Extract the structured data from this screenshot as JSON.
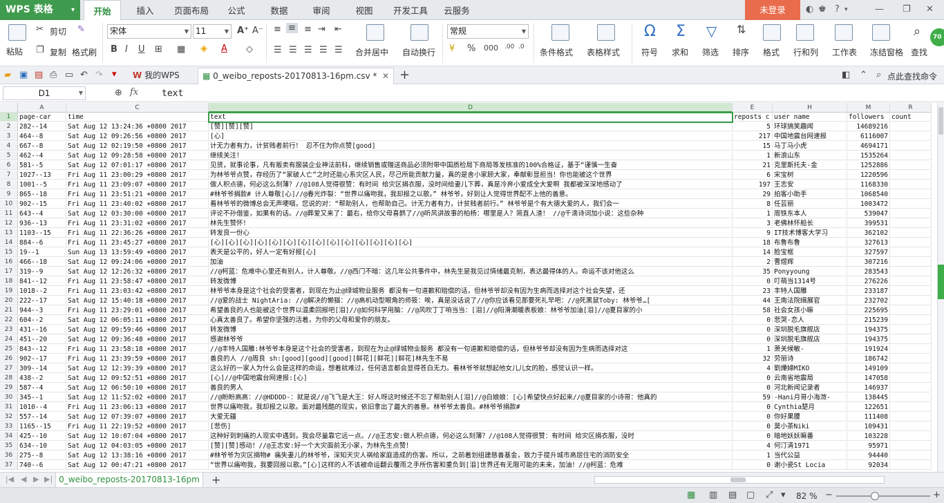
{
  "app": {
    "name": "WPS 表格",
    "login": "未登录"
  },
  "menu": [
    "开始",
    "插入",
    "页面布局",
    "公式",
    "数据",
    "审阅",
    "视图",
    "开发工具",
    "云服务"
  ],
  "ribbon": {
    "paste": "粘贴",
    "cut": "剪切",
    "copy": "复制",
    "format_painter": "格式刷",
    "font": "宋体",
    "font_size": "11",
    "merge": "合并居中",
    "wrap": "自动换行",
    "number_format": "常规",
    "cond_format": "条件格式",
    "table_style": "表格样式",
    "symbol": "符号",
    "sum": "求和",
    "filter": "筛选",
    "sort": "排序",
    "format": "格式",
    "rowcol": "行和列",
    "worksheet": "工作表",
    "freeze": "冻结窗格",
    "find": "查找",
    "zoom_badge": "70"
  },
  "tabs": {
    "home": "我的WPS",
    "file": "0_weibo_reposts-20170813-16pm.csv *",
    "search": "点此查找命令"
  },
  "formula": {
    "cell": "D1",
    "fx": "fx",
    "value": "text"
  },
  "columns": [
    "A",
    "C",
    "D",
    "E",
    "H",
    "M",
    "R"
  ],
  "rows": [
    {
      "n": "1",
      "a": "page-car",
      "c": "time",
      "d": "text",
      "e": "reposts c",
      "h": "user name",
      "m": "followers",
      "r": "count"
    },
    {
      "n": "2",
      "a": "282--14",
      "c": "Sat Aug 12 13:24:36 +0800 2017",
      "d": "[赞][赞][赞]",
      "e": "5",
      "h": "环球搞笑趣闻",
      "m": "14689216",
      "r": ""
    },
    {
      "n": "3",
      "a": "464--8",
      "c": "Sat Aug 12 09:26:56 +0800 2017",
      "d": "[心]",
      "e": "217",
      "h": "中国地震台网速报",
      "m": "6116007",
      "r": ""
    },
    {
      "n": "4",
      "a": "667--8",
      "c": "Sat Aug 12 02:19:50 +0800 2017",
      "d": "计无力者有力，计贫贱者前行！ 忍不住为你点赞[good]",
      "e": "15",
      "h": "马丁马小虎",
      "m": "4694171",
      "r": ""
    },
    {
      "n": "5",
      "a": "462--4",
      "c": "Sat Aug 12 09:28:58 +0800 2017",
      "d": "继续关注！",
      "e": "1",
      "h": "新浪山东",
      "m": "1535264",
      "r": ""
    },
    {
      "n": "6",
      "a": "581--5",
      "c": "Sat Aug 12 07:01:17 +0800 2017",
      "d": "见贤，就事论事，凡有贩卖有服装企业神法前科，继续销售或赠送商品必须附带中国质检局下商局等发核准的100%合格证，基于“谨慎一生奋",
      "e": "21",
      "h": "克里斯托夫-金",
      "m": "1252886",
      "r": ""
    },
    {
      "n": "7",
      "a": "1027--13",
      "c": "Fri Aug 11 23:00:29 +0800 2017",
      "d": "为林爷爷点赞，存经历了“家破人亡”之时还能心系灾区人民，尽己所能贡献力量，真的是舍小家顾大家，奉献彰显担当！你也能被这个世界",
      "e": "6",
      "h": "宋宝树",
      "m": "1220596",
      "r": ""
    },
    {
      "n": "8",
      "a": "1001--5",
      "c": "Fri Aug 11 23:09:07 +0800 2017",
      "d": "做人积点德，何必这么刻薄？//@108人觉得很赞：有时间 给灾区捐衣服，没时间给妻儿下葬，真是冷弃小爱成全大爱啊 我都被深深地感动了",
      "e": "197",
      "h": "王志安",
      "m": "1168330",
      "r": ""
    },
    {
      "n": "9",
      "a": "865--18",
      "c": "Fri Aug 11 23:51:21 +0800 2017",
      "d": "#林爷爷捐款# 计人尊敬[心]//@春光炸裂：“世界以痛吻我，我却报之以歌。” 林爷爷，好到让人觉得世界配不上他的善意。",
      "e": "29",
      "h": "拍客小助手",
      "m": "1068540",
      "r": ""
    },
    {
      "n": "10",
      "a": "902--15",
      "c": "Fri Aug 11 23:40:02 +0800 2017",
      "d": "看林爷爷的微博总会无声哽咽，您说的对：“帮助别人，也帮助自己。计无力者有力，计贫贱者前行。” 林爷爷是个有大德大爱的人，我们会一",
      "e": "8",
      "h": "任芸丽",
      "m": "1003472",
      "r": ""
    },
    {
      "n": "11",
      "a": "643--4",
      "c": "Sat Aug 12 03:30:00 +0800 2017",
      "d": "评论不孙借鉴，如果有的话。//@葬爱又来了：最右，给你父母喜鹊了//@听风讲故事的柏杨：哪里是人？简直人渣！ //@千滴诗词加小说：这些杂种",
      "e": "1",
      "h": "周铁东本人",
      "m": "539047",
      "r": ""
    },
    {
      "n": "12",
      "a": "936--13",
      "c": "Fri Aug 11 23:31:02 +0800 2017",
      "d": "林先生赞怀！",
      "e": "3",
      "h": "老佛林怀船长",
      "m": "399531",
      "r": ""
    },
    {
      "n": "13",
      "a": "1103--15",
      "c": "Fri Aug 11 22:36:26 +0800 2017",
      "d": "转发良一份心",
      "e": "9",
      "h": "IT技术博客大学习",
      "m": "362102",
      "r": ""
    },
    {
      "n": "14",
      "a": "884--6",
      "c": "Fri Aug 11 23:45:27 +0800 2017",
      "d": "[心][心][心][心][心][心][心][心][心][心][心][心][心][心]",
      "e": "18",
      "h": "布鲁布鲁",
      "m": "327613",
      "r": ""
    },
    {
      "n": "15",
      "a": "19--1",
      "c": "Sun Aug 13 13:59:49 +0800 2017",
      "d": "表天是公平的，好人一定有好报[心]",
      "e": "14",
      "h": "脸宝框",
      "m": "327597",
      "r": ""
    },
    {
      "n": "16",
      "a": "466--18",
      "c": "Sat Aug 12 09:24:06 +0800 2017",
      "d": "加油",
      "e": "2",
      "h": "曹煜辉",
      "m": "307216",
      "r": ""
    },
    {
      "n": "17",
      "a": "319--9",
      "c": "Sat Aug 12 12:26:32 +0800 2017",
      "d": "//@柯蓝：危难中心里还有别人，计人尊敬。//@西门不暗：这几年公共事件中，林先生是我见过情绪最克制，表达最得体的人。命运不该对他这么",
      "e": "35",
      "h": "Ponyyoung",
      "m": "283543",
      "r": ""
    },
    {
      "n": "18",
      "a": "841--12",
      "c": "Fri Aug 11 23:58:47 +0800 2017",
      "d": "转发微博",
      "e": "0",
      "h": "叮萌当1314号",
      "m": "276226",
      "r": ""
    },
    {
      "n": "19",
      "a": "1018--2",
      "c": "Fri Aug 11 23:03:42 +0800 2017",
      "d": "林爷爷本身是这个社会的受害者，到现在为止@绿城物业服务 都没有一句道歉和赔偿的话，但林爷爷却没有因为生病而选择对这个社会失望，还",
      "e": "23",
      "h": "丰特人国雕",
      "m": "233187",
      "r": ""
    },
    {
      "n": "20",
      "a": "222--17",
      "c": "Sat Aug 12 15:40:18 +0800 2017",
      "d": "//@爱的战士 NightAria: //@解决的懒猫：//@高机动型眼角的师筱：唉，真是没话说了//@你应该看见那要死礼早吧：//@死黑鼠Toby: 林爷爷…[",
      "e": "44",
      "h": "王南法院缉展官",
      "m": "232702",
      "r": ""
    },
    {
      "n": "21",
      "a": "944--3",
      "c": "Fri Aug 11 23:29:01 +0800 2017",
      "d": "希望善良的人也能被这个世界以温柔回报吧[泪]//@如何科学用脑：//@风吹丁丁响当当：[泪]//@阳滑潮暖表板娘：林爷爷加油[泪]//@夏目家的小",
      "e": "58",
      "h": "社会女孩小嘛",
      "m": "225695",
      "r": ""
    },
    {
      "n": "22",
      "a": "604--2",
      "c": "Sat Aug 12 06:05:11 +0800 2017",
      "d": "心真太善良了。希望你坚强的活着，为你的父母和爱你的朋友。",
      "e": "0",
      "h": "悲哭-恋人",
      "m": "215239",
      "r": ""
    },
    {
      "n": "23",
      "a": "431--16",
      "c": "Sat Aug 12 09:59:46 +0800 2017",
      "d": "转发微博",
      "e": "0",
      "h": "深圳脱毛旗舰店",
      "m": "194375",
      "r": ""
    },
    {
      "n": "24",
      "a": "451--20",
      "c": "Sat Aug 12 09:36:48 +0800 2017",
      "d": "感谢林爷爷",
      "e": "0",
      "h": "深圳脱毛旗舰店",
      "m": "194375",
      "r": ""
    },
    {
      "n": "25",
      "a": "843--12",
      "c": "Fri Aug 11 23:58:18 +0800 2017",
      "d": "//@丰特人国雕:林爷爷本身是这个社会的受害者，到现在为止@绿城物业服务 都没有一句道歉和赔偿的话，但林爷爷却没有因为生病而选择对这",
      "e": "1",
      "h": "萧关候敏-",
      "m": "191924",
      "r": ""
    },
    {
      "n": "26",
      "a": "902--17",
      "c": "Fri Aug 11 23:39:59 +0800 2017",
      "d": "善良的人 //@周良 sh:[good][good][good][鲜花][鲜花][鲜花]林先生不易",
      "e": "32",
      "h": "劳丽诗",
      "m": "186742",
      "r": ""
    },
    {
      "n": "27",
      "a": "309--14",
      "c": "Sat Aug 12 12:39:39 +0800 2017",
      "d": "这么好的一家人为什么会是这样的命运，想着就难过，任何语言都会显得苍白无力。看林爷爷就想起他女儿儿女的脸，感觉认识一样。",
      "e": "4",
      "h": "劉燁婦MIKO",
      "m": "149109",
      "r": ""
    },
    {
      "n": "28",
      "a": "438--2",
      "c": "Sat Aug 12 09:52:51 +0800 2017",
      "d": "[心]//@中国地震台网速报:[心]",
      "e": "0",
      "h": "云南省地震局",
      "m": "147058",
      "r": ""
    },
    {
      "n": "29",
      "a": "587--4",
      "c": "Sat Aug 12 06:50:10 +0800 2017",
      "d": "善良的男人",
      "e": "0",
      "h": "河北新闻记录者",
      "m": "146937",
      "r": ""
    },
    {
      "n": "30",
      "a": "345--1",
      "c": "Sat Aug 12 11:52:02 +0800 2017",
      "d": "//@盼盼高高：//@HDDDD-：就是说//@飞飞是大王：好人呀这时候还不忘了帮助别人[泪]//@白娘娘：[心]希望快点好起来//@夏目家的小诗哥：他真的",
      "e": "59",
      "h": "-Hani月哥小海溦-",
      "m": "138445",
      "r": ""
    },
    {
      "n": "31",
      "a": "1010--4",
      "c": "Fri Aug 11 23:06:13 +0800 2017",
      "d": "世界以痛吻我，我却报之以歌。面对最残酷的现实，依旧拿出了最大的善意。林爷爷太善良。#林爷爷捐款#",
      "e": "0",
      "h": "Cynthia楚月",
      "m": "122651",
      "r": ""
    },
    {
      "n": "32",
      "a": "557--14",
      "c": "Sat Aug 12 07:39:07 +0800 2017",
      "d": "大爱无疆",
      "e": "0",
      "h": "你好果腰",
      "m": "111408",
      "r": ""
    },
    {
      "n": "33",
      "a": "1165--15",
      "c": "Fri Aug 11 22:19:52 +0800 2017",
      "d": "[悲伤]",
      "e": "0",
      "h": "莫小茶Niki",
      "m": "109431",
      "r": ""
    },
    {
      "n": "34",
      "a": "425--10",
      "c": "Sat Aug 12 10:07:04 +0800 2017",
      "d": "这种好到刺痛的人现实中遇到，我会尽量靠它远一点。//@王志安:做人积点德，何必这么刻薄？//@108人觉得很赞：有时间 给灾区捐衣服，没时",
      "e": "0",
      "h": "暗地妖妖嘛番",
      "m": "103228",
      "r": ""
    },
    {
      "n": "35",
      "a": "634--10",
      "c": "Sat Aug 12 04:03:05 +0800 2017",
      "d": "[赞][赞]感动！//@王志安:好一个大灾面前无小家，为林先生点赞！",
      "e": "4",
      "h": "何汀清1971",
      "m": "95971",
      "r": ""
    },
    {
      "n": "36",
      "a": "275--8",
      "c": "Sat Aug 12 13:38:16 +0800 2017",
      "d": "#林爷爷为灾区捐物# 痛失妻儿的林爷爷，深知天灾人祸给家庭造成的伤害。所以，之前着划组建慈善基金，致力于提升城市高层住宅的消防安全",
      "e": "1",
      "h": "当代公益",
      "m": "94440",
      "r": ""
    },
    {
      "n": "37",
      "a": "740--6",
      "c": "Sat Aug 12 00:47:21 +0800 2017",
      "d": "“世界以痛吻我，我要回报以歌。”[心]这样的人不该被命运翻云覆雨之手所伤害和重负到[泪]世界还有无限可能的未来，加油！//@柯蓝：危难",
      "e": "0",
      "h": "谢小瓷St Locia",
      "m": "92034",
      "r": ""
    }
  ],
  "sheet": {
    "name": "0_weibo_reposts-20170813-16pm"
  },
  "status": {
    "zoom": "82 %"
  }
}
